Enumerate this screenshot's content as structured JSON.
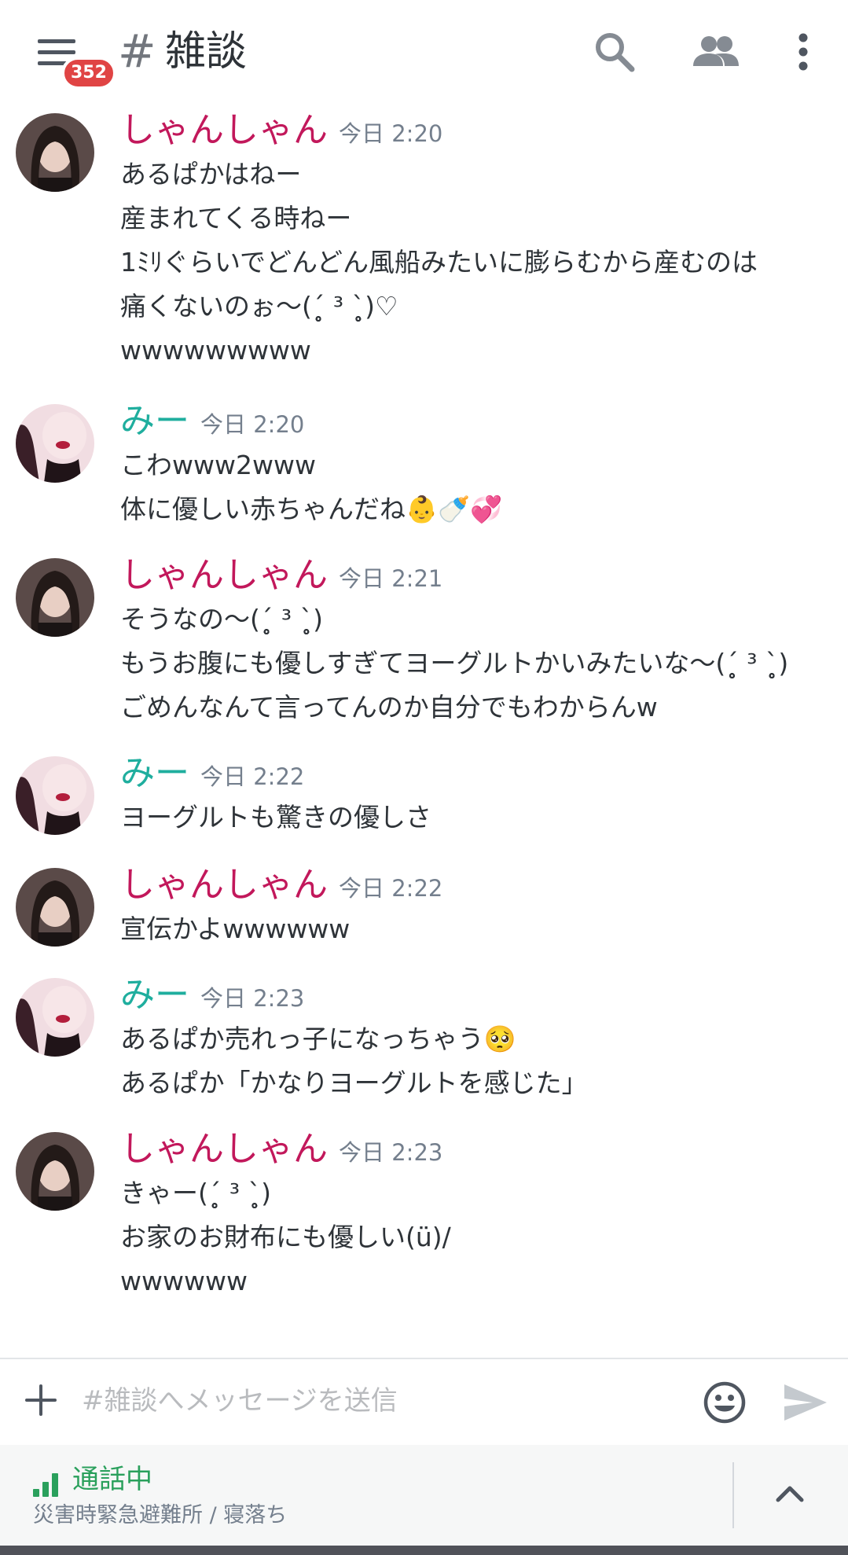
{
  "header": {
    "unread_count": "352",
    "channel_hash": "#",
    "channel_name": "雑談"
  },
  "messages": [
    {
      "author": "しゃんしゃん",
      "time": "今日 2:20",
      "lines": [
        "あるぱかはねー",
        "産まれてくる時ねー",
        "1ﾐﾘぐらいでどんどん風船みたいに膨らむから産むのは",
        "痛くないのぉ〜(ˊ̥̥̥̥̥ ³ ˋ̥̥̥̥̥)♡",
        "wwwwwwwww"
      ]
    },
    {
      "author": "みー",
      "time": "今日 2:20",
      "lines": [
        "こわwww2www",
        "体に優しい赤ちゃんだね👶🍼💞"
      ]
    },
    {
      "author": "しゃんしゃん",
      "time": "今日 2:21",
      "lines": [
        "そうなの〜(ˊ̥̥̥̥̥ ³ ˋ̥̥̥̥̥)",
        "もうお腹にも優しすぎてヨーグルトかいみたいな〜(ˊ̥̥̥̥̥ ³ ˋ̥̥̥̥̥)",
        "ごめんなんて言ってんのか自分でもわからんw"
      ]
    },
    {
      "author": "みー",
      "time": "今日 2:22",
      "lines": [
        "ヨーグルトも驚きの優しさ"
      ]
    },
    {
      "author": "しゃんしゃん",
      "time": "今日 2:22",
      "lines": [
        "宣伝かよwwwwww"
      ]
    },
    {
      "author": "みー",
      "time": "今日 2:23",
      "lines": [
        "あるぱか売れっ子になっちゃう🥺",
        "あるぱか「かなりヨーグルトを感じた」"
      ]
    },
    {
      "author": "しゃんしゃん",
      "time": "今日 2:23",
      "lines": [
        "きゃー(ˊ̥̥̥̥̥ ³ ˋ̥̥̥̥̥)",
        "お家のお財布にも優しい(ü)/",
        "wwwwww"
      ]
    }
  ],
  "composer": {
    "placeholder": "#雑談へメッセージを送信"
  },
  "voice": {
    "status": "通話中",
    "channel": "災害時緊急避難所 / 寝落ち"
  },
  "icons": {
    "menu": "hamburger-menu-icon",
    "search": "search-icon",
    "members": "members-icon",
    "more": "more-vertical-icon",
    "add": "plus-icon",
    "emoji": "emoji-icon",
    "send": "send-icon",
    "signal": "signal-bars-icon",
    "expand": "chevron-up-icon"
  },
  "colors": {
    "author_shanshan": "#c2185b",
    "author_mii": "#1fae9e",
    "badge": "#e04444",
    "voice_connected": "#2aa05c"
  }
}
